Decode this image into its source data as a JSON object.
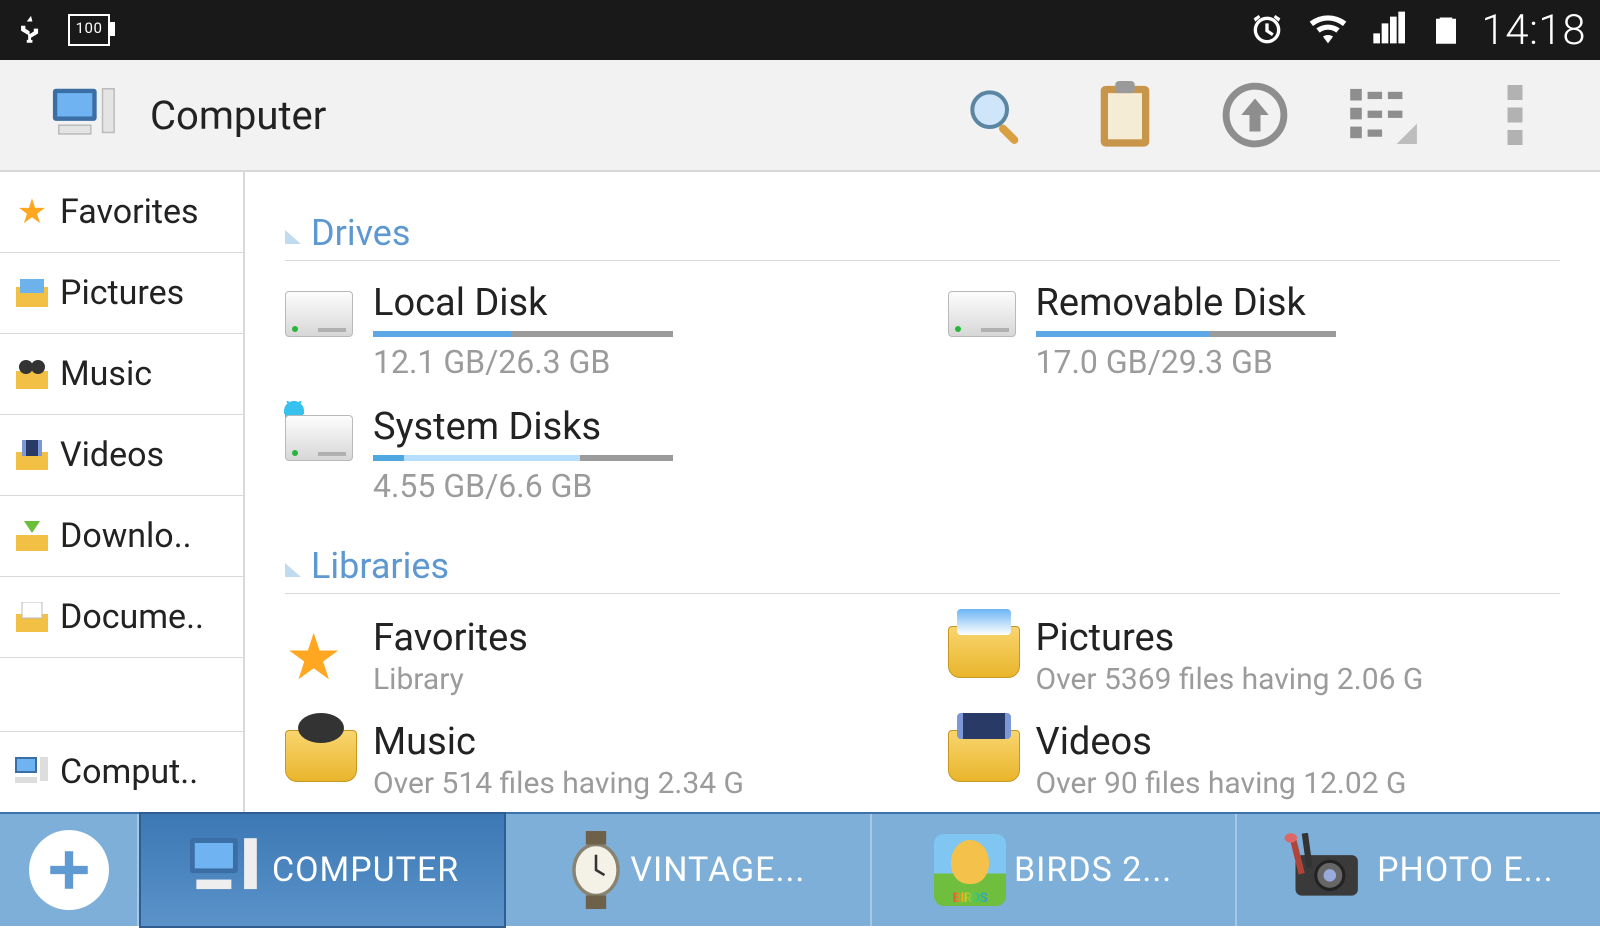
{
  "status": {
    "battery_label": "100",
    "time": "14:18"
  },
  "appbar": {
    "title": "Computer"
  },
  "sidebar": {
    "items": [
      {
        "label": "Favorites",
        "icon": "star-icon"
      },
      {
        "label": "Pictures",
        "icon": "picture-icon"
      },
      {
        "label": "Music",
        "icon": "music-icon"
      },
      {
        "label": "Videos",
        "icon": "video-icon"
      },
      {
        "label": "Downlo..",
        "icon": "download-icon"
      },
      {
        "label": "Docume..",
        "icon": "document-icon"
      }
    ],
    "bottom": {
      "label": "Comput..",
      "icon": "computer-icon"
    }
  },
  "sections": {
    "drives_title": "Drives",
    "libraries_title": "Libraries"
  },
  "drives": [
    {
      "name": "Local Disk",
      "usage": "12.1 GB/26.3 GB",
      "fill_pct": 46,
      "icon": "disk"
    },
    {
      "name": "Removable Disk",
      "usage": "17.0 GB/29.3 GB",
      "fill_pct": 58,
      "icon": "disk"
    },
    {
      "name": "System Disks",
      "usage": "4.55 GB/6.6 GB",
      "fill_pct": 69,
      "icon": "disk-android"
    }
  ],
  "libraries": [
    {
      "name": "Favorites",
      "sub": "Library",
      "icon": "star"
    },
    {
      "name": "Pictures",
      "sub": "Over 5369 files having 2.06 G",
      "icon": "pictures"
    },
    {
      "name": "Music",
      "sub": "Over 514 files having 2.34 G",
      "icon": "music"
    },
    {
      "name": "Videos",
      "sub": "Over 90 files having 12.02 G",
      "icon": "videos"
    }
  ],
  "tabs": [
    {
      "label": "COMPUTER",
      "icon": "computer",
      "selected": true
    },
    {
      "label": "VINTAGE...",
      "icon": "watch",
      "selected": false
    },
    {
      "label": "BIRDS 2...",
      "icon": "birds",
      "selected": false
    },
    {
      "label": "PHOTO E...",
      "icon": "photo",
      "selected": false
    }
  ]
}
